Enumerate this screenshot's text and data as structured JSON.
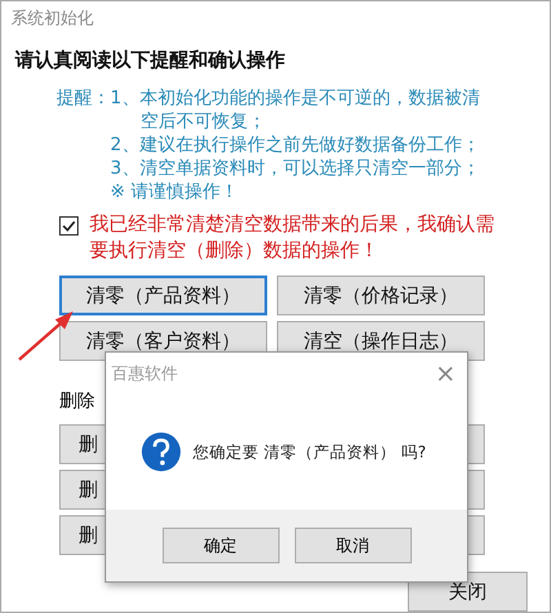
{
  "window": {
    "title": "系统初始化"
  },
  "heading": "请认真阅读以下提醒和确认操作",
  "notice": {
    "label": "提醒：",
    "lines": [
      "1、本初始化功能的操作是不可逆的，数据被清空后不可恢复；",
      "2、建议在执行操作之前先做好数据备份工作；",
      "3、清空单据资料时，可以选择只清空一部分；",
      "※  请谨慎操作！"
    ]
  },
  "confirm": {
    "checked": true,
    "label": "我已经非常清楚清空数据带来的后果，我确认需要执行清空（删除）数据的操作！"
  },
  "clear_buttons": [
    {
      "label": "清零（产品资料）",
      "focused": true
    },
    {
      "label": "清零（价格记录）",
      "focused": false
    },
    {
      "label": "清零（客户资料）",
      "focused": false
    },
    {
      "label": "清空（操作日志）",
      "focused": false
    }
  ],
  "delete_section": {
    "label": "删除",
    "buttons": [
      "删",
      "删",
      "删"
    ]
  },
  "close_button": "关闭",
  "dialog": {
    "title": "百惠软件",
    "close": "×",
    "message": "您确定要 清零（产品资料） 吗?",
    "buttons": [
      "确定",
      "取消"
    ]
  }
}
